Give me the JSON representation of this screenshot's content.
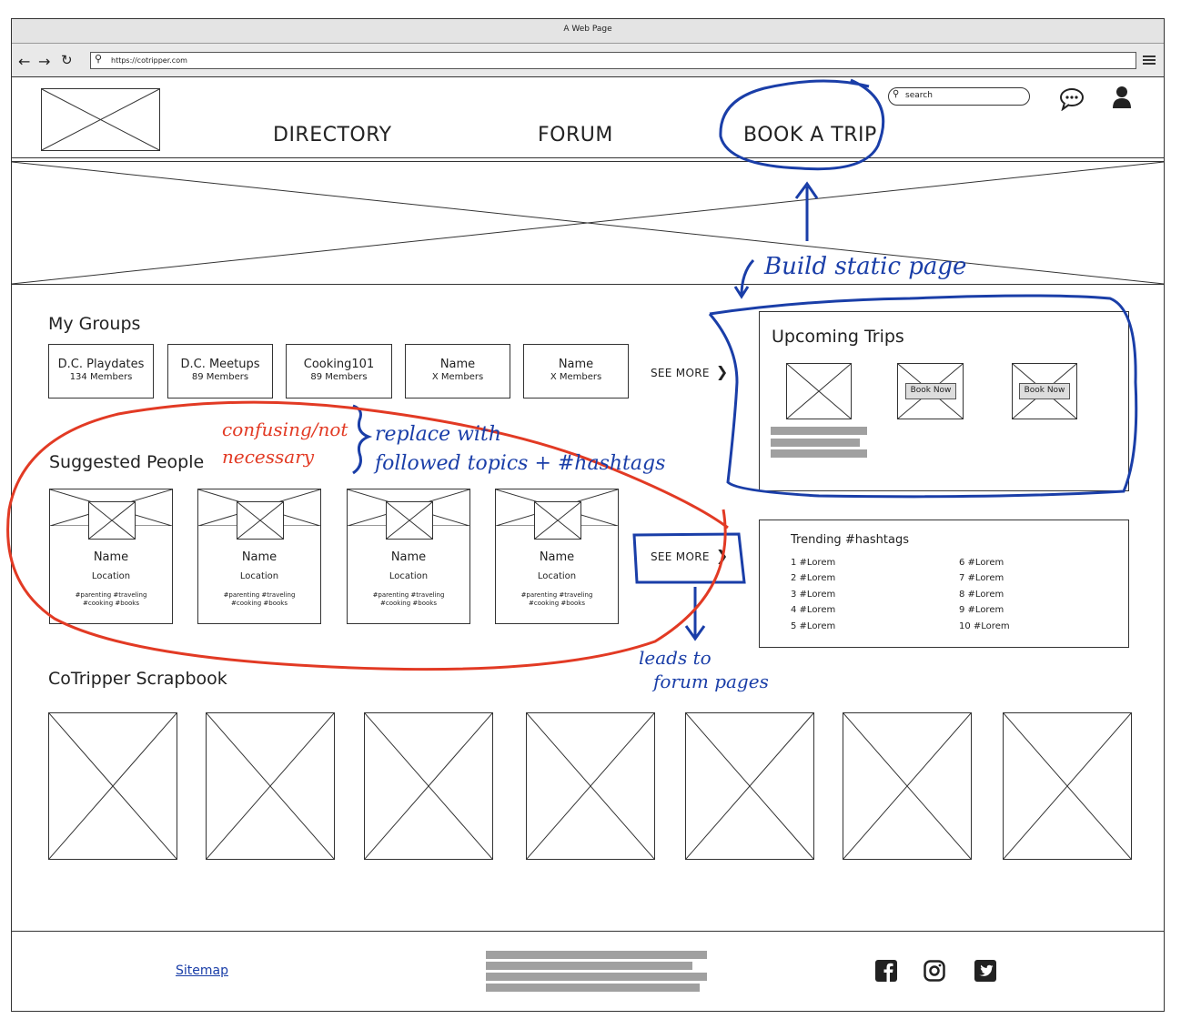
{
  "browser": {
    "window_title": "A Web Page",
    "url": "https://cotripper.com"
  },
  "header": {
    "search_placeholder": "search",
    "nav": [
      "DIRECTORY",
      "FORUM",
      "BOOK A TRIP"
    ]
  },
  "my_groups": {
    "title": "My Groups",
    "groups": [
      {
        "name": "D.C. Playdates",
        "members": "134 Members"
      },
      {
        "name": "D.C. Meetups",
        "members": "89 Members"
      },
      {
        "name": "Cooking101",
        "members": "89 Members"
      },
      {
        "name": "Name",
        "members": "X Members"
      },
      {
        "name": "Name",
        "members": "X Members"
      }
    ],
    "see_more": "SEE MORE"
  },
  "upcoming_trips": {
    "title": "Upcoming Trips",
    "book_now": "Book Now"
  },
  "suggested_people": {
    "title": "Suggested People",
    "people": [
      {
        "name": "Name",
        "location": "Location",
        "tags_line1": "#parenting #traveling",
        "tags_line2": "#cooking #books"
      },
      {
        "name": "Name",
        "location": "Location",
        "tags_line1": "#parenting #traveling",
        "tags_line2": "#cooking #books"
      },
      {
        "name": "Name",
        "location": "Location",
        "tags_line1": "#parenting #traveling",
        "tags_line2": "#cooking #books"
      },
      {
        "name": "Name",
        "location": "Location",
        "tags_line1": "#parenting #traveling",
        "tags_line2": "#cooking #books"
      }
    ],
    "see_more": "SEE MORE"
  },
  "trending": {
    "title": "Trending #hashtags",
    "tags": [
      "1 #Lorem",
      "2 #Lorem",
      "3 #Lorem",
      "4 #Lorem",
      "5 #Lorem",
      "6 #Lorem",
      "7 #Lorem",
      "8 #Lorem",
      "9 #Lorem",
      "10 #Lorem"
    ]
  },
  "scrapbook": {
    "title": "CoTripper Scrapbook"
  },
  "footer": {
    "sitemap": "Sitemap",
    "social_icons": [
      "facebook-icon",
      "instagram-icon",
      "twitter-icon"
    ]
  },
  "annotations": {
    "build_static_page": "Build static page",
    "confusing_line1": "confusing/not",
    "confusing_line2": "necessary",
    "replace_line1": "replace with",
    "replace_line2": "followed topics + #hashtags",
    "leads_line1": "leads to",
    "leads_line2": "forum pages"
  },
  "colors": {
    "annotation_blue": "#1a3ea8",
    "annotation_red": "#e23a24",
    "placeholder_bar": "#a0a0a0"
  }
}
